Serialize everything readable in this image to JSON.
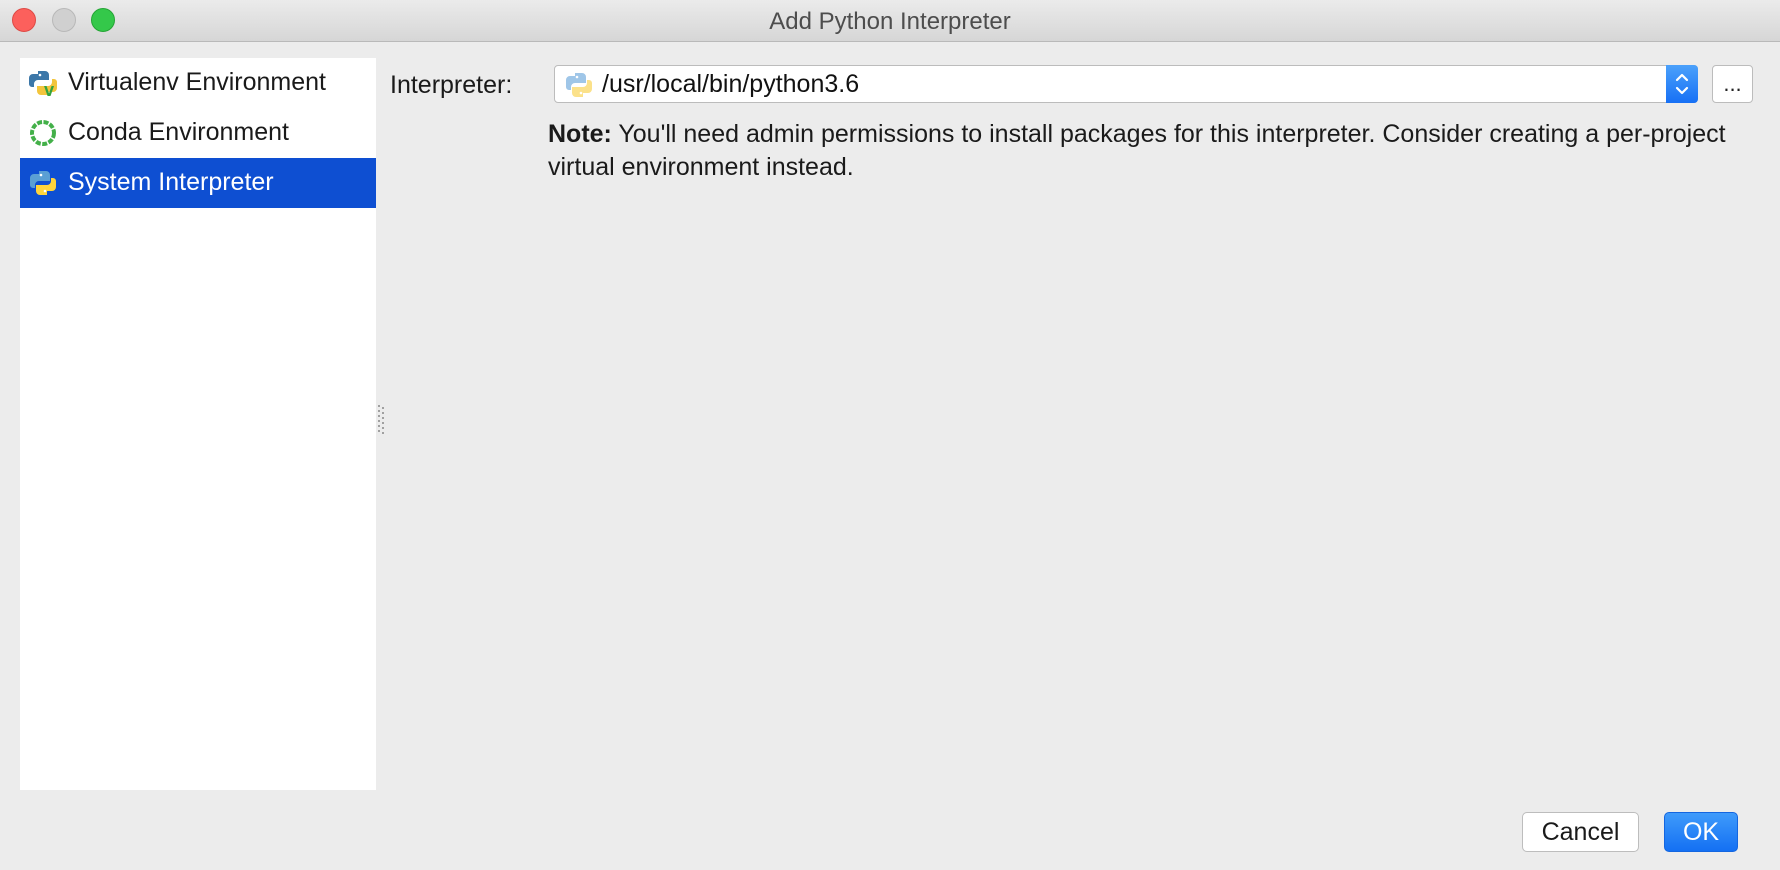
{
  "window": {
    "title": "Add Python Interpreter"
  },
  "sidebar": {
    "items": [
      {
        "label": "Virtualenv Environment",
        "icon": "virtualenv-icon",
        "selected": false
      },
      {
        "label": "Conda Environment",
        "icon": "conda-icon",
        "selected": false
      },
      {
        "label": "System Interpreter",
        "icon": "python-icon",
        "selected": true
      }
    ]
  },
  "main": {
    "interpreter_label": "Interpreter:",
    "interpreter_value": "/usr/local/bin/python3.6",
    "browse_label": "...",
    "note_bold": "Note:",
    "note_text": " You'll need admin permissions to install packages for this interpreter. Consider creating a per-project virtual environment instead."
  },
  "footer": {
    "cancel_label": "Cancel",
    "ok_label": "OK"
  },
  "colors": {
    "selection": "#0e4fd2",
    "accent": "#1770f5",
    "close": "#fc605c",
    "maximize": "#34c84a"
  }
}
